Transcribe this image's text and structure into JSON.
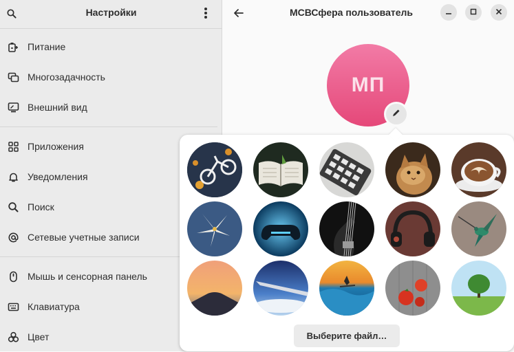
{
  "sidebar": {
    "title": "Настройки",
    "items": [
      {
        "label": "Питание",
        "icon": "battery-icon"
      },
      {
        "label": "Многозадачность",
        "icon": "multitasking-icon"
      },
      {
        "label": "Внешний вид",
        "icon": "appearance-icon"
      },
      {
        "label": "Приложения",
        "icon": "apps-grid-icon"
      },
      {
        "label": "Уведомления",
        "icon": "bell-icon"
      },
      {
        "label": "Поиск",
        "icon": "search-icon"
      },
      {
        "label": "Сетевые учетные записи",
        "icon": "at-sign-icon"
      },
      {
        "label": "Мышь и сенсорная панель",
        "icon": "mouse-icon"
      },
      {
        "label": "Клавиатура",
        "icon": "keyboard-icon"
      },
      {
        "label": "Цвет",
        "icon": "color-icon"
      }
    ]
  },
  "main": {
    "title": "МСВСфера пользователь",
    "avatar_initials": "МП",
    "avatar_color": "#e8558a"
  },
  "picker": {
    "images": [
      "bicycle-sign-image",
      "open-book-image",
      "calculator-image",
      "cat-image",
      "coffee-latte-image",
      "lily-flower-image",
      "gamepad-image",
      "bass-guitar-image",
      "headphones-image",
      "hummingbird-image",
      "mountain-sunset-image",
      "airplane-wing-image",
      "surfer-image",
      "tomatoes-image",
      "tree-field-image"
    ],
    "choose_file_label": "Выберите файл…"
  }
}
